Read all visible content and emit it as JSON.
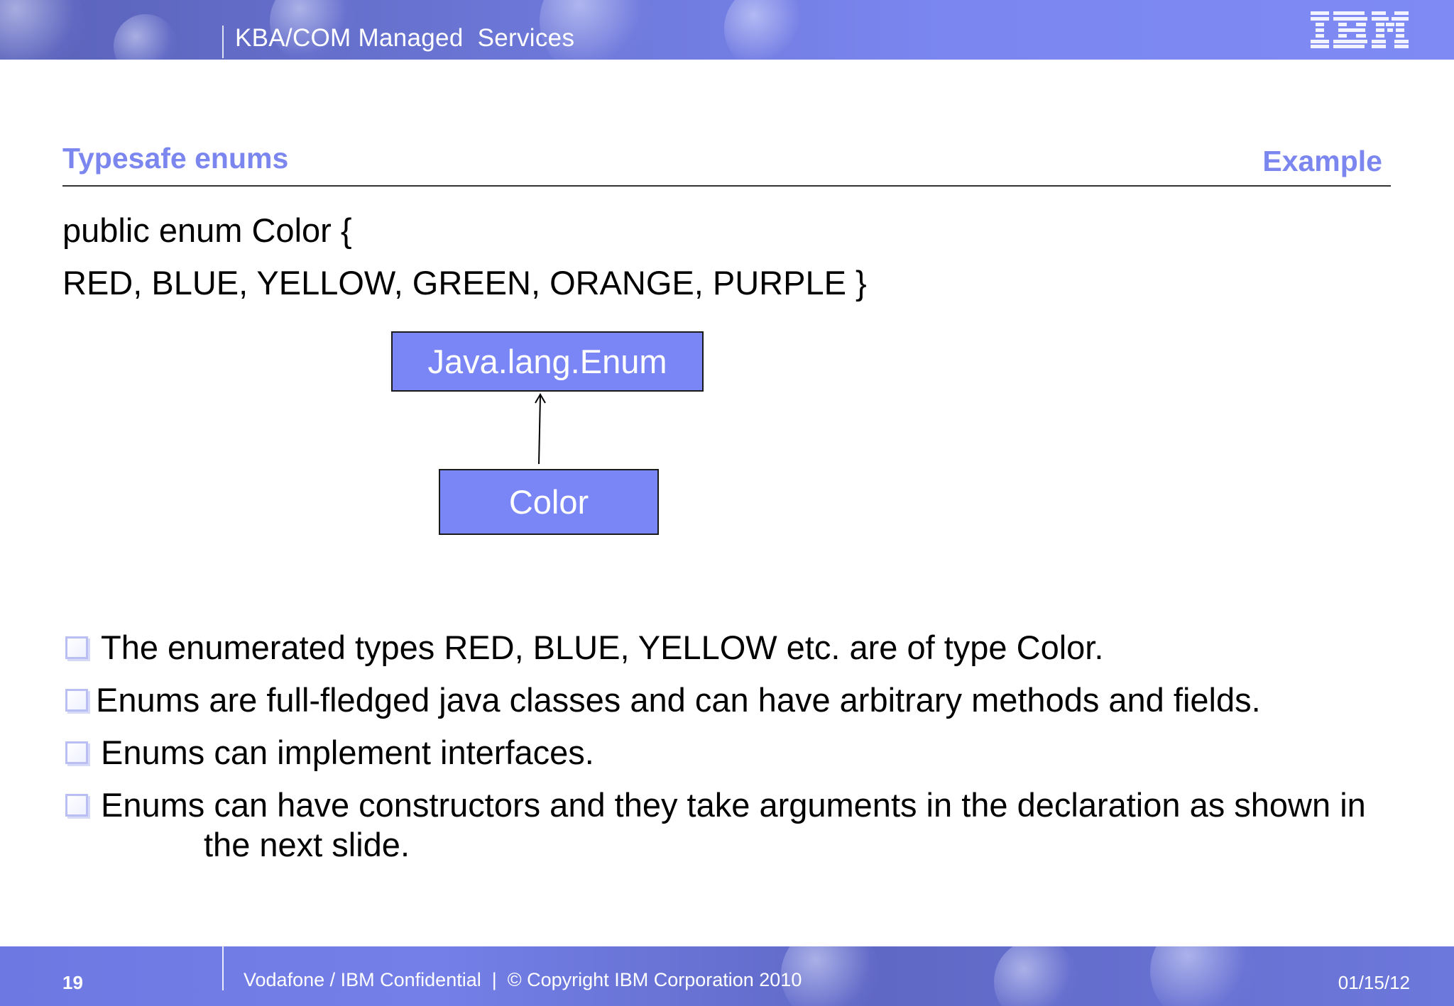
{
  "header": {
    "title": "KBA/COM Managed  Services",
    "logo_text": "IBM"
  },
  "slide": {
    "section_title": "Typesafe enums",
    "section_label": "Example",
    "code_lines": [
      "public enum Color {",
      "RED, BLUE, YELLOW, GREEN, ORANGE, PURPLE }"
    ],
    "diagram": {
      "parent_class": "Java.lang.Enum",
      "child_class": "Color"
    },
    "bullets": [
      " The enumerated types RED, BLUE, YELLOW etc. are of type Color.",
      "Enums are full-fledged java classes and can have arbitrary methods and fields.",
      " Enums can implement interfaces.",
      " Enums can have constructors and they take arguments in the declaration as shown in"
    ],
    "bullet4_continuation": "the next slide."
  },
  "footer": {
    "page_number": "19",
    "confidential": "Vodafone / IBM Confidential  |  © Copyright IBM Corporation 2010",
    "date": "01/15/12"
  },
  "colors": {
    "accent": "#7b86ef",
    "box_fill": "#7b86f6",
    "banner": "#7f8af5"
  }
}
